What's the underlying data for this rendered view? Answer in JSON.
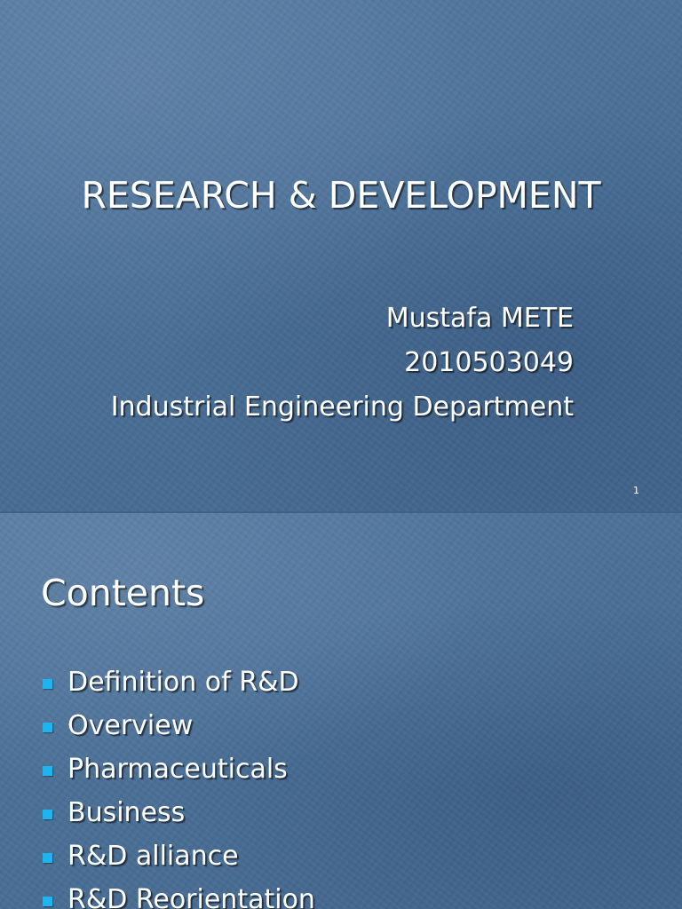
{
  "slide1": {
    "title": "RESEARCH & DEVELOPMENT",
    "author_name": "Mustafa METE",
    "student_id": "2010503049",
    "department": "Industrial Engineering Department",
    "slide_number": "1"
  },
  "slide2": {
    "heading": "Contents",
    "items": [
      {
        "label": "Definition of R&D"
      },
      {
        "label": "Overview"
      },
      {
        "label": "Pharmaceuticals"
      },
      {
        "label": "Business"
      },
      {
        "label": "R&D alliance"
      },
      {
        "label": "R&D Reorientation"
      }
    ]
  },
  "colors": {
    "background": "#4a6e94",
    "text": "#ffffff",
    "bullet": "#1fb4ee"
  }
}
